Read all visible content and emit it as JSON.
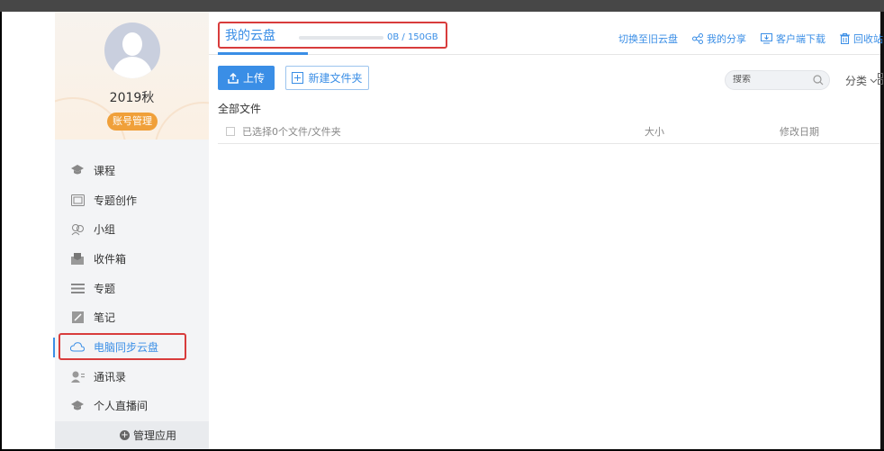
{
  "profile": {
    "username": "2019秋",
    "account_button": "账号管理"
  },
  "menu": {
    "items": [
      {
        "label": "课程",
        "icon": "course-icon"
      },
      {
        "label": "专题创作",
        "icon": "topic-create-icon"
      },
      {
        "label": "小组",
        "icon": "group-icon"
      },
      {
        "label": "收件箱",
        "icon": "inbox-icon"
      },
      {
        "label": "专题",
        "icon": "topic-icon"
      },
      {
        "label": "笔记",
        "icon": "note-icon"
      },
      {
        "label": "电脑同步云盘",
        "icon": "cloud-icon",
        "active": true
      },
      {
        "label": "通讯录",
        "icon": "contacts-icon"
      },
      {
        "label": "个人直播间",
        "icon": "live-icon"
      }
    ],
    "manage_apps": "管理应用"
  },
  "header": {
    "title": "我的云盘",
    "storage": {
      "used_fraction": 0.0,
      "text": "0B / 150GB"
    },
    "actions": [
      {
        "label": "切换至旧云盘",
        "icon": "switch-icon"
      },
      {
        "label": "我的分享",
        "icon": "share-icon"
      },
      {
        "label": "客户端下载",
        "icon": "monitor-download-icon"
      },
      {
        "label": "回收站",
        "icon": "trash-icon"
      }
    ]
  },
  "toolbar": {
    "upload_label": "上传",
    "new_folder_label": "新建文件夹",
    "search_placeholder": "搜索",
    "sort_label": "分类"
  },
  "files": {
    "section_title": "全部文件",
    "selected_text": "已选择0个文件/文件夹",
    "columns": {
      "size": "大小",
      "date": "修改日期"
    },
    "rows": []
  },
  "colors": {
    "accent": "#3a8ee6",
    "badge": "#f0a03a",
    "highlight": "#d83c3c"
  }
}
